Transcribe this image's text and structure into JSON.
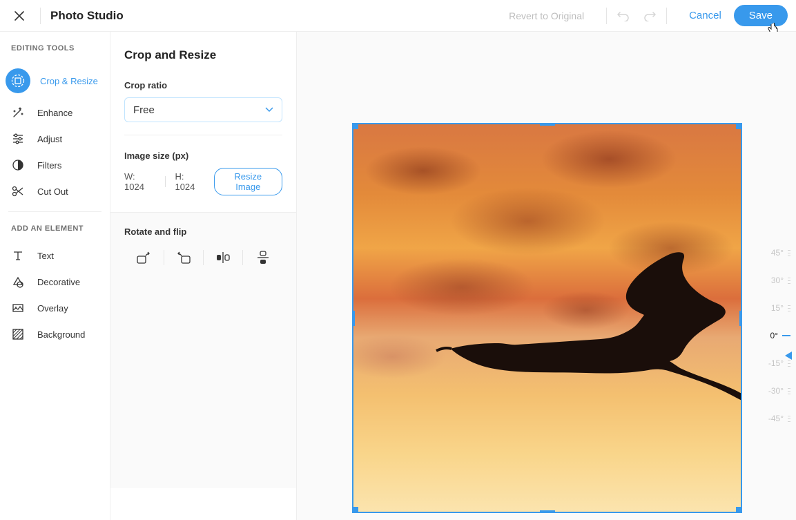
{
  "header": {
    "title": "Photo Studio",
    "revert": "Revert to Original",
    "cancel": "Cancel",
    "save": "Save"
  },
  "sidebar": {
    "tools_label": "EDITING TOOLS",
    "elements_label": "ADD AN ELEMENT",
    "tools": [
      {
        "label": "Crop & Resize",
        "icon": "crop-icon",
        "active": true
      },
      {
        "label": "Enhance",
        "icon": "wand-icon"
      },
      {
        "label": "Adjust",
        "icon": "sliders-icon"
      },
      {
        "label": "Filters",
        "icon": "drop-icon"
      },
      {
        "label": "Cut Out",
        "icon": "scissors-icon"
      }
    ],
    "elements": [
      {
        "label": "Text",
        "icon": "text-icon"
      },
      {
        "label": "Decorative",
        "icon": "decorative-icon"
      },
      {
        "label": "Overlay",
        "icon": "overlay-icon"
      },
      {
        "label": "Background",
        "icon": "background-icon"
      }
    ]
  },
  "panel": {
    "title": "Crop and Resize",
    "crop_ratio_label": "Crop ratio",
    "crop_ratio_value": "Free",
    "image_size_label": "Image size (px)",
    "width_label": "W:",
    "width_value": "1024",
    "height_label": "H:",
    "height_value": "1024",
    "resize_label": "Resize Image",
    "rotate_label": "Rotate and flip"
  },
  "rotation": {
    "ticks": [
      "45°",
      "30°",
      "15°",
      "0°",
      "-15°",
      "-30°",
      "-45°"
    ],
    "active": "0°"
  }
}
